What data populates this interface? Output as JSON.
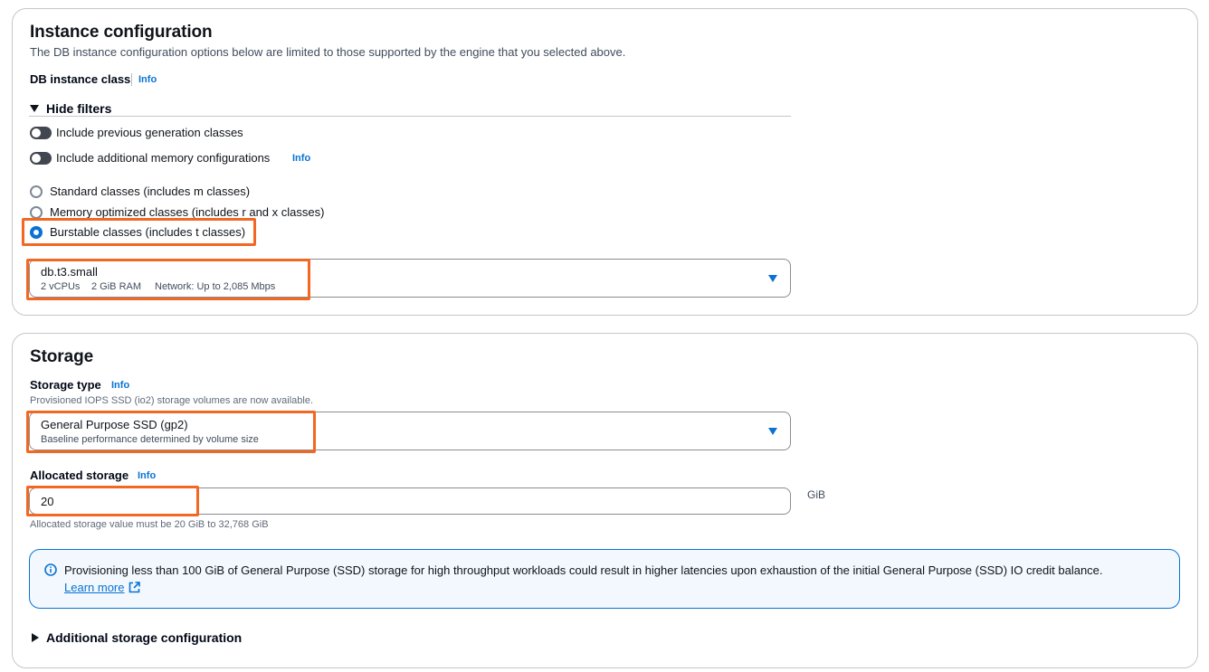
{
  "instance_config": {
    "title": "Instance configuration",
    "description": "The DB instance configuration options below are limited to those supported by the engine that you selected above.",
    "db_class_label": "DB instance class",
    "info": "Info",
    "filters_toggle": "Hide filters",
    "toggles": [
      {
        "label": "Include previous generation classes",
        "on": false
      },
      {
        "label": "Include additional memory configurations",
        "on": false,
        "info": "Info"
      }
    ],
    "radios": [
      {
        "label": "Standard classes (includes m classes)",
        "checked": false
      },
      {
        "label": "Memory optimized classes (includes r and x classes)",
        "checked": false
      },
      {
        "label": "Burstable classes (includes t classes)",
        "checked": true
      }
    ],
    "instance_select": {
      "value": "db.t3.small",
      "vcpus": "2 vCPUs",
      "ram": "2 GiB RAM",
      "network": "Network: Up to 2,085 Mbps"
    }
  },
  "storage": {
    "title": "Storage",
    "type_label": "Storage type",
    "info": "Info",
    "type_note": "Provisioned IOPS SSD (io2) storage volumes are now available.",
    "type_select": {
      "value": "General Purpose SSD (gp2)",
      "description": "Baseline performance determined by volume size"
    },
    "allocated_label": "Allocated storage",
    "allocated_value": "20",
    "unit": "GiB",
    "allocated_hint": "Allocated storage value must be 20 GiB to 32,768 GiB",
    "alert_text": "Provisioning less than 100 GiB of General Purpose (SSD) storage for high throughput workloads could result in higher latencies upon exhaustion of the initial General Purpose (SSD) IO credit balance.",
    "learn_more": "Learn more",
    "additional_config": "Additional storage configuration"
  },
  "colors": {
    "accent": "#0972d3",
    "highlight": "#f26722",
    "border": "#c6c6cd",
    "alert_bg": "#f2f8fd"
  }
}
